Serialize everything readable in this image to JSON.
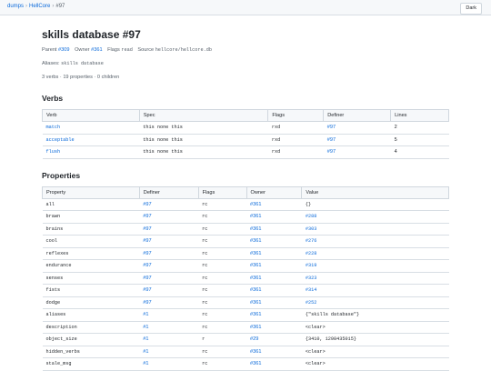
{
  "breadcrumb": {
    "root": "dumps",
    "db": "HellCore",
    "current": "#97"
  },
  "theme_button": "Dark",
  "title": "skills database #97",
  "meta": {
    "parent_label": "Parent",
    "parent_value": "#309",
    "owner_label": "Owner",
    "owner_value": "#361",
    "flags_label": "Flags",
    "flags_value": "read",
    "source_label": "Source",
    "source_value": "hellcore/hellcore.db"
  },
  "aliases": {
    "label": "Aliases:",
    "value": "skills database"
  },
  "counts": "3 verbs · 19 properties · 0 children",
  "verbs": {
    "heading": "Verbs",
    "columns": [
      "Verb",
      "Spec",
      "Flags",
      "Definer",
      "Lines"
    ],
    "rows": [
      {
        "verb": "match",
        "spec": "this none this",
        "flags": "rxd",
        "definer": "#97",
        "lines": "2"
      },
      {
        "verb": "acceptable",
        "spec": "this none this",
        "flags": "rxd",
        "definer": "#97",
        "lines": "5"
      },
      {
        "verb": "flush",
        "spec": "this none this",
        "flags": "rxd",
        "definer": "#97",
        "lines": "4"
      }
    ]
  },
  "properties": {
    "heading": "Properties",
    "columns": [
      "Property",
      "Definer",
      "Flags",
      "Owner",
      "Value"
    ],
    "rows": [
      {
        "property": "all",
        "definer": "#97",
        "flags": "rc",
        "owner": "#361",
        "value": "{}",
        "value_link": false
      },
      {
        "property": "brawn",
        "definer": "#97",
        "flags": "rc",
        "owner": "#361",
        "value": "#288",
        "value_link": true
      },
      {
        "property": "brains",
        "definer": "#97",
        "flags": "rc",
        "owner": "#361",
        "value": "#303",
        "value_link": true
      },
      {
        "property": "cool",
        "definer": "#97",
        "flags": "rc",
        "owner": "#361",
        "value": "#276",
        "value_link": true
      },
      {
        "property": "reflexes",
        "definer": "#97",
        "flags": "rc",
        "owner": "#361",
        "value": "#228",
        "value_link": true
      },
      {
        "property": "endurance",
        "definer": "#97",
        "flags": "rc",
        "owner": "#361",
        "value": "#319",
        "value_link": true
      },
      {
        "property": "senses",
        "definer": "#97",
        "flags": "rc",
        "owner": "#361",
        "value": "#323",
        "value_link": true
      },
      {
        "property": "fists",
        "definer": "#97",
        "flags": "rc",
        "owner": "#361",
        "value": "#314",
        "value_link": true
      },
      {
        "property": "dodge",
        "definer": "#97",
        "flags": "rc",
        "owner": "#361",
        "value": "#252",
        "value_link": true
      },
      {
        "property": "aliases",
        "definer": "#1",
        "flags": "rc",
        "owner": "#361",
        "value": "{\"skills database\"}",
        "value_link": false
      },
      {
        "property": "description",
        "definer": "#1",
        "flags": "rc",
        "owner": "#361",
        "value": "<clear>",
        "value_link": false
      },
      {
        "property": "object_size",
        "definer": "#1",
        "flags": "r",
        "owner": "#29",
        "value": "{3410, 1298435015}",
        "value_link": false
      },
      {
        "property": "hidden_verbs",
        "definer": "#1",
        "flags": "rc",
        "owner": "#361",
        "value": "<clear>",
        "value_link": false
      },
      {
        "property": "stale_msg",
        "definer": "#1",
        "flags": "rc",
        "owner": "#361",
        "value": "<clear>",
        "value_link": false
      }
    ]
  }
}
